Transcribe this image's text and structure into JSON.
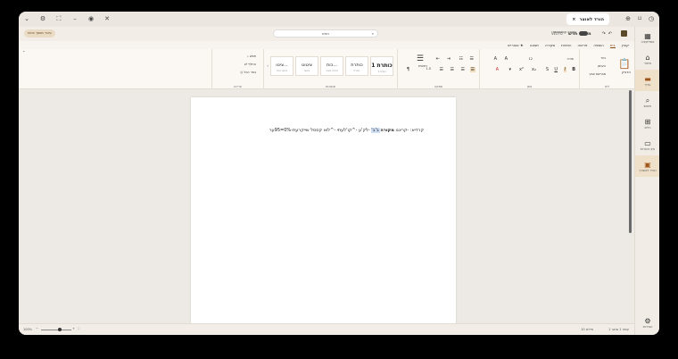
{
  "browser": {
    "tab_title": "הורד לאוצר",
    "tab_close": "×"
  },
  "app": {
    "title": "מסמך חדש",
    "subtitle": "- Word",
    "search_placeholder": "חפש",
    "autosave_label": "שמירה אוטומטית",
    "edit_mode_pill": "עיבוד מסמך פתוח"
  },
  "rail": [
    {
      "icon": "apps-icon",
      "glyph": "▦",
      "label": "אפליקציה"
    },
    {
      "icon": "home-icon",
      "glyph": "⌂",
      "label": "איחוד"
    },
    {
      "icon": "doc-icon",
      "glyph": "▤",
      "label": ""
    },
    {
      "icon": "active-app-icon",
      "glyph": "▬",
      "label": "עריך"
    },
    {
      "icon": "search-icon",
      "glyph": "⌕",
      "label": "חיפוש"
    },
    {
      "icon": "grid-icon",
      "glyph": "⊞",
      "label": "כלים"
    },
    {
      "icon": "book-icon",
      "glyph": "▭",
      "label": "עיון והערות"
    },
    {
      "icon": "save-icon",
      "glyph": "▣",
      "label": "הורד לאוצרך"
    },
    {
      "icon": "settings-icon",
      "glyph": "⚙",
      "label": "הגדרות"
    }
  ],
  "ribbon_tabs": [
    "קובץ",
    "בית",
    "הוספה",
    "פריסה",
    "הפניות",
    "סקירה",
    "תצוגה",
    "★ אוצרייא"
  ],
  "active_tab": "בית",
  "ribbon": {
    "clipboard": {
      "paste": "הדבק",
      "cut": "גזור",
      "copy": "העתק",
      "format": "מברשת צבע",
      "label": "לוח"
    },
    "font": {
      "name": "אורה",
      "size": "12",
      "label": "גופן"
    },
    "paragraph": {
      "spacing": "1.5",
      "label": "פסקה",
      "title_btn": "ראשית"
    },
    "styles": {
      "label": "סגנונות",
      "items": [
        {
          "title": "כותרת 1",
          "sub": "כותרת 1"
        },
        {
          "title": "כותרת",
          "sub": "כותרת"
        },
        {
          "title": "כות...",
          "sub": "כותרת משנה"
        },
        {
          "title": "ציטוט",
          "sub": "ציטוט"
        },
        {
          "title": "ציטו...",
          "sub": "ציטוט בולט"
        }
      ]
    },
    "editing": {
      "find": "חפש",
      "replace": "החלף",
      "select": "בחר הכל",
      "label": "עריכה"
    }
  },
  "document": {
    "before": "קרדיא: -קריגנו ",
    "bold": "מקורה",
    "highlight": " ב'ב'",
    "after": " -לק'ע -^קו'לעתי -^לוא קססל שייקרעת-0%=95ער"
  },
  "status": {
    "zoom": "100%",
    "page_info": "עמוד 1 מתוך 1",
    "words": "10 מילים"
  }
}
